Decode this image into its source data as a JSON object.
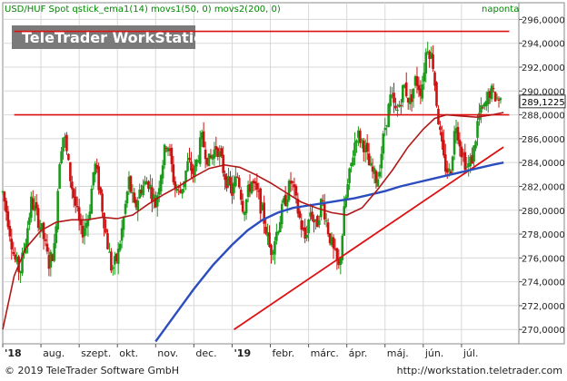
{
  "header": {
    "title": "USD/HUF Spot qstick_ema1(14) movs1(50, 0) movs2(200, 0)",
    "period": "naponta",
    "watermark": "TeleTrader WorkStation"
  },
  "footer": {
    "copyright": "© 2019 TeleTrader Software GmbH",
    "url": "http://workstation.teletrader.com"
  },
  "colors": {
    "candle_up": "#1a9a1a",
    "candle_down": "#cc1111",
    "ma50": "#b01818",
    "ma200": "#2b4dbf",
    "levels": "#dd1111",
    "trendline": "#dd1111",
    "title_text": "#008800",
    "grid": "#d8d8d8"
  },
  "chart_data": {
    "type": "candlestick",
    "instrument": "USD/HUF Spot",
    "ylim": [
      268.8,
      297.4
    ],
    "y_ticks": [
      270,
      272,
      274,
      276,
      278,
      280,
      282,
      284,
      286,
      288,
      290,
      292,
      294,
      296
    ],
    "y_tick_labels": [
      "270,0000",
      "272,0000",
      "274,0000",
      "276,0000",
      "278,0000",
      "280,0000",
      "282,0000",
      "284,0000",
      "286,0000",
      "288,0000",
      "290,0000",
      "292,0000",
      "294,0000",
      "296,0000"
    ],
    "last_price_label": "289,1225",
    "last_price": 289.1225,
    "x_labels": [
      {
        "label": "'18",
        "bold": true
      },
      {
        "label": "aug.",
        "bold": false
      },
      {
        "label": "szept.",
        "bold": false
      },
      {
        "label": "okt.",
        "bold": false
      },
      {
        "label": "nov.",
        "bold": false
      },
      {
        "label": "dec.",
        "bold": false
      },
      {
        "label": "'19",
        "bold": true
      },
      {
        "label": "febr.",
        "bold": false
      },
      {
        "label": "márc.",
        "bold": false
      },
      {
        "label": "ápr.",
        "bold": false
      },
      {
        "label": "máj.",
        "bold": false
      },
      {
        "label": "jún.",
        "bold": false
      },
      {
        "label": "júl.",
        "bold": false
      }
    ],
    "x_label_months": [
      0,
      1,
      2,
      3,
      4,
      5,
      6,
      7,
      8,
      9,
      10,
      11,
      12
    ],
    "month_range": [
      0,
      13.5
    ],
    "close_path": [
      [
        0.0,
        281.5
      ],
      [
        0.15,
        279.0
      ],
      [
        0.3,
        276.0
      ],
      [
        0.45,
        274.8
      ],
      [
        0.6,
        277.5
      ],
      [
        0.75,
        280.8
      ],
      [
        0.9,
        279.5
      ],
      [
        1.05,
        278.0
      ],
      [
        1.2,
        275.5
      ],
      [
        1.35,
        276.8
      ],
      [
        1.5,
        285.0
      ],
      [
        1.6,
        286.5
      ],
      [
        1.75,
        283.0
      ],
      [
        1.9,
        280.5
      ],
      [
        2.05,
        278.0
      ],
      [
        2.25,
        279.5
      ],
      [
        2.4,
        284.0
      ],
      [
        2.55,
        281.5
      ],
      [
        2.7,
        278.0
      ],
      [
        2.85,
        275.0
      ],
      [
        3.0,
        276.0
      ],
      [
        3.15,
        279.0
      ],
      [
        3.3,
        282.5
      ],
      [
        3.45,
        280.0
      ],
      [
        3.6,
        281.8
      ],
      [
        3.8,
        282.5
      ],
      [
        4.0,
        280.5
      ],
      [
        4.15,
        283.5
      ],
      [
        4.3,
        286.0
      ],
      [
        4.5,
        282.0
      ],
      [
        4.65,
        281.5
      ],
      [
        4.85,
        284.0
      ],
      [
        5.0,
        283.0
      ],
      [
        5.2,
        286.0
      ],
      [
        5.4,
        284.0
      ],
      [
        5.6,
        285.5
      ],
      [
        5.8,
        283.0
      ],
      [
        6.0,
        281.5
      ],
      [
        6.15,
        283.0
      ],
      [
        6.3,
        280.0
      ],
      [
        6.5,
        282.5
      ],
      [
        6.7,
        281.0
      ],
      [
        6.85,
        279.0
      ],
      [
        7.0,
        276.5
      ],
      [
        7.15,
        278.0
      ],
      [
        7.35,
        280.5
      ],
      [
        7.55,
        282.5
      ],
      [
        7.75,
        279.5
      ],
      [
        7.9,
        277.5
      ],
      [
        8.05,
        280.0
      ],
      [
        8.2,
        278.5
      ],
      [
        8.35,
        281.0
      ],
      [
        8.5,
        278.5
      ],
      [
        8.65,
        276.5
      ],
      [
        8.8,
        275.0
      ],
      [
        8.95,
        280.5
      ],
      [
        9.1,
        283.5
      ],
      [
        9.25,
        286.5
      ],
      [
        9.45,
        285.5
      ],
      [
        9.6,
        283.5
      ],
      [
        9.8,
        282.5
      ],
      [
        10.0,
        287.0
      ],
      [
        10.15,
        289.5
      ],
      [
        10.3,
        288.0
      ],
      [
        10.5,
        290.5
      ],
      [
        10.65,
        289.0
      ],
      [
        10.8,
        291.0
      ],
      [
        10.95,
        290.0
      ],
      [
        11.1,
        294.0
      ],
      [
        11.25,
        292.5
      ],
      [
        11.35,
        289.0
      ],
      [
        11.45,
        286.0
      ],
      [
        11.55,
        283.8
      ],
      [
        11.7,
        283.0
      ],
      [
        11.85,
        287.5
      ],
      [
        12.0,
        285.0
      ],
      [
        12.15,
        283.5
      ],
      [
        12.3,
        284.5
      ],
      [
        12.45,
        288.0
      ],
      [
        12.6,
        288.5
      ],
      [
        12.75,
        290.0
      ],
      [
        12.9,
        289.5
      ],
      [
        13.05,
        289.1
      ]
    ],
    "ma50_path": [
      [
        0.0,
        270.0
      ],
      [
        0.3,
        274.5
      ],
      [
        0.6,
        276.8
      ],
      [
        1.0,
        278.3
      ],
      [
        1.4,
        279.0
      ],
      [
        1.8,
        279.2
      ],
      [
        2.2,
        279.2
      ],
      [
        2.6,
        279.4
      ],
      [
        3.0,
        279.3
      ],
      [
        3.4,
        279.6
      ],
      [
        3.8,
        280.5
      ],
      [
        4.2,
        281.3
      ],
      [
        4.6,
        282.0
      ],
      [
        5.0,
        282.8
      ],
      [
        5.4,
        283.5
      ],
      [
        5.8,
        283.8
      ],
      [
        6.2,
        283.6
      ],
      [
        6.6,
        283.0
      ],
      [
        7.0,
        282.3
      ],
      [
        7.4,
        281.5
      ],
      [
        7.8,
        280.7
      ],
      [
        8.2,
        280.2
      ],
      [
        8.6,
        279.8
      ],
      [
        9.0,
        279.6
      ],
      [
        9.4,
        280.2
      ],
      [
        9.8,
        281.7
      ],
      [
        10.2,
        283.4
      ],
      [
        10.6,
        285.3
      ],
      [
        11.0,
        286.8
      ],
      [
        11.3,
        287.7
      ],
      [
        11.6,
        288.0
      ],
      [
        12.0,
        287.9
      ],
      [
        12.4,
        287.8
      ],
      [
        12.8,
        288.0
      ],
      [
        13.1,
        288.2
      ]
    ],
    "ma200_path": [
      [
        4.0,
        269.0
      ],
      [
        4.5,
        271.2
      ],
      [
        5.0,
        273.4
      ],
      [
        5.5,
        275.4
      ],
      [
        6.0,
        277.1
      ],
      [
        6.4,
        278.3
      ],
      [
        6.8,
        279.2
      ],
      [
        7.2,
        279.8
      ],
      [
        7.6,
        280.2
      ],
      [
        8.0,
        280.4
      ],
      [
        8.4,
        280.6
      ],
      [
        8.8,
        280.8
      ],
      [
        9.2,
        281.0
      ],
      [
        9.6,
        281.3
      ],
      [
        10.0,
        281.6
      ],
      [
        10.4,
        282.0
      ],
      [
        10.8,
        282.3
      ],
      [
        11.2,
        282.6
      ],
      [
        11.6,
        282.9
      ],
      [
        12.0,
        283.2
      ],
      [
        12.4,
        283.5
      ],
      [
        12.8,
        283.8
      ],
      [
        13.1,
        284.0
      ]
    ],
    "h_levels": [
      295.0,
      288.0
    ],
    "trendline": [
      [
        6.05,
        270.0
      ],
      [
        13.1,
        285.3
      ]
    ]
  }
}
